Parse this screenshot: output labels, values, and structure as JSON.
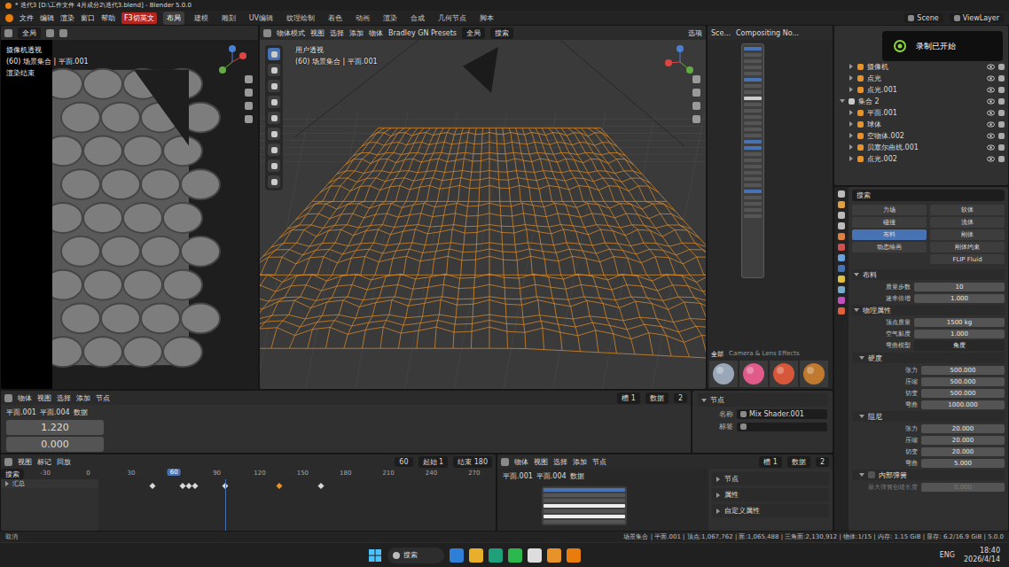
{
  "window": {
    "title": "* 迭代3 [D:\\工作文件 4月成分2\\迭代3.blend] - Blender 5.0.0"
  },
  "menu": [
    "文件",
    "编辑",
    "渲染",
    "窗口",
    "帮助"
  ],
  "badge": "F3切英文",
  "workspaces": [
    {
      "label": "布局",
      "selected": true
    },
    {
      "label": "建模",
      "selected": false
    },
    {
      "label": "雕刻",
      "selected": false
    },
    {
      "label": "UV编辑",
      "selected": false
    },
    {
      "label": "纹理绘制",
      "selected": false
    },
    {
      "label": "着色",
      "selected": false
    },
    {
      "label": "动画",
      "selected": false
    },
    {
      "label": "渲染",
      "selected": false
    },
    {
      "label": "合成",
      "selected": false
    },
    {
      "label": "几何节点",
      "selected": false
    },
    {
      "label": "脚本",
      "selected": false
    }
  ],
  "scene": "Scene",
  "view_layer": "ViewLayer",
  "camera_view": {
    "orientation": "全局",
    "overlay": [
      "摄像机透视",
      "(60) 场景集合 | 平面.001",
      "渲染结束"
    ]
  },
  "viewport": {
    "menus": [
      "物体模式",
      "视图",
      "选择",
      "添加",
      "物体",
      "Bradley GN Presets"
    ],
    "orientation": "全局",
    "search": "搜索",
    "options": "选项",
    "overlay": [
      "用户透视",
      "(60) 场景集合 | 平面.001"
    ]
  },
  "compositor": {
    "breadcrumb": [
      "Sce...",
      "Compositing No..."
    ],
    "asset_tabs": [
      {
        "label": "全部",
        "selected": true
      },
      {
        "label": "Camera & Lens Effects",
        "selected": false
      }
    ]
  },
  "notification": "录制已开始",
  "outliner": {
    "items": [
      {
        "name": "摄像机",
        "nested": true,
        "expanded": false
      },
      {
        "name": "点光",
        "nested": true,
        "expanded": false
      },
      {
        "name": "点光.001",
        "nested": true,
        "expanded": false
      },
      {
        "name": "集合 2",
        "nested": false,
        "expanded": true
      },
      {
        "name": "平面.001",
        "nested": true,
        "expanded": false
      },
      {
        "name": "球体",
        "nested": true,
        "expanded": false
      },
      {
        "name": "空物体.002",
        "nested": true,
        "expanded": false
      },
      {
        "name": "贝塞尔曲线.001",
        "nested": true,
        "expanded": false
      },
      {
        "name": "点光.002",
        "nested": true,
        "expanded": false
      }
    ]
  },
  "properties": {
    "search": "搜索",
    "physics_left": [
      {
        "label": "力场",
        "selected": false
      },
      {
        "label": "碰撞",
        "selected": false
      },
      {
        "label": "布料",
        "selected": true
      },
      {
        "label": "动态绘画",
        "selected": false
      }
    ],
    "physics_right": [
      {
        "label": "软体",
        "selected": false
      },
      {
        "label": "流体",
        "selected": false
      },
      {
        "label": "刚体",
        "selected": false
      },
      {
        "label": "刚体约束",
        "selected": false
      },
      {
        "label": "FLIP Fluid",
        "selected": false
      }
    ],
    "sections": [
      {
        "title": "布料",
        "nested": false,
        "checkbox": false,
        "has_checkbox": false,
        "rows": [
          {
            "label": "质量步数",
            "value": "10",
            "kind": "field",
            "disabled": false
          },
          {
            "label": "速率倍增",
            "value": "1.000",
            "kind": "field",
            "disabled": false
          }
        ]
      },
      {
        "title": "物理属性",
        "nested": false,
        "checkbox": false,
        "has_checkbox": false,
        "rows": [
          {
            "label": "顶点质量",
            "value": "1500 kg",
            "kind": "field",
            "disabled": false
          },
          {
            "label": "空气黏度",
            "value": "1.000",
            "kind": "field",
            "disabled": false
          },
          {
            "label": "弯曲模型",
            "value": "角度",
            "kind": "dropdown",
            "disabled": false
          }
        ]
      },
      {
        "title": "硬度",
        "nested": true,
        "checkbox": false,
        "has_checkbox": false,
        "rows": [
          {
            "label": "张力",
            "value": "500.000",
            "kind": "field",
            "disabled": false
          },
          {
            "label": "压缩",
            "value": "500.000",
            "kind": "field",
            "disabled": false
          },
          {
            "label": "切变",
            "value": "500.000",
            "kind": "field",
            "disabled": false
          },
          {
            "label": "弯曲",
            "value": "1000.000",
            "kind": "field",
            "disabled": false
          }
        ]
      },
      {
        "title": "阻尼",
        "nested": true,
        "checkbox": false,
        "has_checkbox": false,
        "rows": [
          {
            "label": "张力",
            "value": "20.000",
            "kind": "field",
            "disabled": false
          },
          {
            "label": "压缩",
            "value": "20.000",
            "kind": "field",
            "disabled": false
          },
          {
            "label": "切变",
            "value": "20.000",
            "kind": "field",
            "disabled": false
          },
          {
            "label": "弯曲",
            "value": "5.000",
            "kind": "field",
            "disabled": false
          }
        ]
      },
      {
        "title": "内部弹簧",
        "nested": true,
        "checkbox": false,
        "has_checkbox": true,
        "rows": [
          {
            "label": "最大弹簧创建长度",
            "value": "0.000",
            "kind": "field",
            "disabled": true
          }
        ]
      }
    ]
  },
  "shader": {
    "menus": [
      "物体",
      "视图",
      "选择",
      "添加",
      "节点"
    ],
    "slot": "槽 1",
    "material": "数据",
    "users": "2",
    "breadcrumb": [
      "平面.001",
      "平面.004",
      "数据"
    ],
    "values": [
      "1.220",
      "0.000"
    ]
  },
  "node_sidebar": {
    "panel": "节点",
    "name_label": "名称",
    "name": "Mix Shader.001",
    "label_label": "标签",
    "label": ""
  },
  "timeline": {
    "menus": [
      "视图",
      "标记",
      "回放"
    ],
    "frame": "60",
    "start_label": "起始",
    "start": "1",
    "end_label": "结束",
    "end": "180",
    "search": "搜索",
    "ticks": [
      "-30",
      "0",
      "30",
      "60",
      "90",
      "120",
      "150",
      "180",
      "210",
      "240",
      "270"
    ],
    "current": 60,
    "track": "汇总",
    "keyframes": [
      {
        "frame": 0,
        "selected": false
      },
      {
        "frame": 25,
        "selected": false
      },
      {
        "frame": 30,
        "selected": false
      },
      {
        "frame": 35,
        "selected": false
      },
      {
        "frame": 60,
        "selected": false
      },
      {
        "frame": 105,
        "selected": true
      },
      {
        "frame": 140,
        "selected": false
      }
    ]
  },
  "node_editor": {
    "menus": [
      "物体",
      "视图",
      "选择",
      "添加",
      "节点"
    ],
    "slot": "槽 1",
    "material": "数据",
    "users": "2",
    "breadcrumb": [
      "平面.001",
      "平面.004",
      "数据"
    ],
    "panels": [
      "节点",
      "属性",
      "自定义属性"
    ]
  },
  "status_bar": {
    "left": "取消",
    "right": "场景集合 | 平面.001 | 顶点:1,067,762 | 面:1,065,488 | 三角面:2,130,912 | 物体:1/15 | 内存: 1.15 GiB | 显存: 6.2/16.9 GiB | 5.0.0"
  },
  "taskbar": {
    "search": "搜索",
    "lang": "ENG",
    "time": "18:40",
    "date": "2026/4/14"
  }
}
